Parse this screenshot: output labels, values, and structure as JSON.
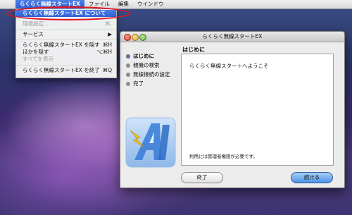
{
  "menubar": {
    "apple": "",
    "items": [
      "らくらく無線スタートEX",
      "ファイル",
      "編集",
      "ウインドウ"
    ]
  },
  "dropdown": {
    "about": "らくらく無線スタートEX について",
    "prefs": {
      "label": "環境設定...",
      "shortcut": "⌘,"
    },
    "services": {
      "label": "サービス",
      "arrow": "▶"
    },
    "hide": {
      "label": "らくらく無線スタートEX を隠す",
      "shortcut": "⌘H"
    },
    "hide_others": {
      "label": "ほかを隠す",
      "shortcut": "⌥⌘H"
    },
    "show_all": "すべてを表示",
    "quit": {
      "label": "らくらく無線スタートEX を終了",
      "shortcut": "⌘Q"
    }
  },
  "window": {
    "title": "らくらく無線スタートEX",
    "steps": [
      "はじめに",
      "親機の検索",
      "無線接続の設定",
      "完了"
    ],
    "current_step": 0,
    "heading": "はじめに",
    "welcome": "らくらく無線スタートへようこそ",
    "admin_note": "利用には管理者権限が必要です。",
    "quit_button": "終了",
    "continue_button": "続ける"
  },
  "colors": {
    "highlight": "#2d5fd4",
    "annotation": "#e5141d"
  }
}
